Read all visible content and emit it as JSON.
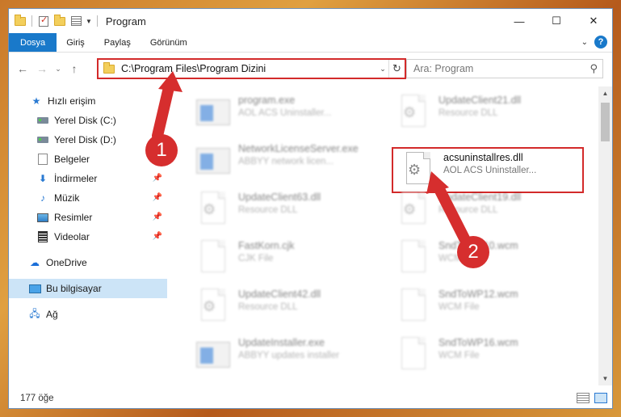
{
  "window": {
    "title": "Program",
    "controls": {
      "minimize": "—",
      "maximize": "☐",
      "close": "✕"
    }
  },
  "ribbon": {
    "tabs": [
      "Dosya",
      "Giriş",
      "Paylaş",
      "Görünüm"
    ],
    "active_tab": "Dosya"
  },
  "address": {
    "path": "C:\\Program Files\\Program Dizini",
    "search_placeholder": "Ara: Program"
  },
  "nav": {
    "items": [
      {
        "label": "Hızlı erişim",
        "icon": "star-icon"
      },
      {
        "label": "Yerel Disk (C:)",
        "icon": "drive-icon"
      },
      {
        "label": "Yerel Disk (D:)",
        "icon": "drive-icon"
      },
      {
        "label": "Belgeler",
        "icon": "documents-icon"
      },
      {
        "label": "İndirmeler",
        "icon": "downloads-icon"
      },
      {
        "label": "Müzik",
        "icon": "music-icon"
      },
      {
        "label": "Resimler",
        "icon": "pictures-icon"
      },
      {
        "label": "Videolar",
        "icon": "videos-icon"
      },
      {
        "label": "OneDrive",
        "icon": "cloud-icon"
      },
      {
        "label": "Bu bilgisayar",
        "icon": "pc-icon"
      },
      {
        "label": "Ağ",
        "icon": "network-icon"
      }
    ],
    "selected": "Bu bilgisayar"
  },
  "files": [
    {
      "name": "program.exe",
      "desc": "AOL ACS Uninstaller..."
    },
    {
      "name": "UpdateClient21.dll",
      "desc": "Resource DLL"
    },
    {
      "name": "NetworkLicenseServer.exe",
      "desc": "ABBYY network licen..."
    },
    {
      "name": "acsuninstallres.dll",
      "desc": "AOL ACS Uninstaller..."
    },
    {
      "name": "UpdateClient63.dll",
      "desc": "Resource DLL"
    },
    {
      "name": "UpdateClient19.dll",
      "desc": "Resource DLL"
    },
    {
      "name": "FastKorn.cjk",
      "desc": "CJK File"
    },
    {
      "name": "SndToWP10.wcm",
      "desc": "WCM File"
    },
    {
      "name": "UpdateClient42.dll",
      "desc": "Resource DLL"
    },
    {
      "name": "SndToWP12.wcm",
      "desc": "WCM File"
    },
    {
      "name": "UpdateInstaller.exe",
      "desc": "ABBYY updates installer"
    },
    {
      "name": "SndToWP16.wcm",
      "desc": "WCM File"
    }
  ],
  "status": {
    "item_count": "177 öğe"
  },
  "annotations": {
    "step1": "1",
    "step2": "2"
  },
  "colors": {
    "accent": "#1979ca",
    "highlight": "#d32a2a",
    "selected_bg": "#cce4f7"
  }
}
